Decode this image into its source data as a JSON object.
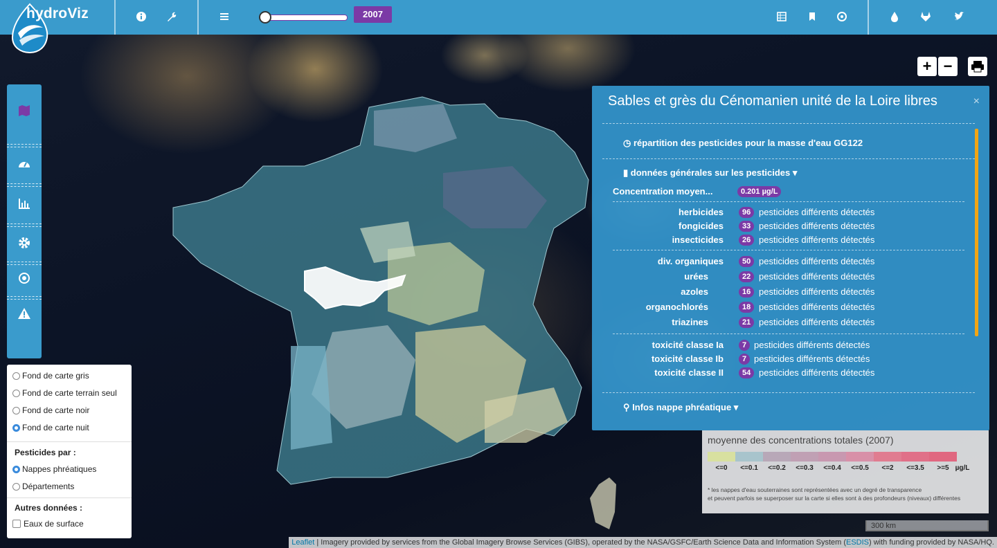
{
  "app": {
    "name": "hydroViz"
  },
  "toolbar": {
    "year": "2007",
    "icons_left": [
      "info-icon",
      "wrench-icon",
      "menu-icon"
    ],
    "icons_right": [
      "table-icon",
      "bookmark-icon",
      "target-icon"
    ],
    "icons_social": [
      "water-drop-icon",
      "gitlab-icon",
      "twitter-icon"
    ]
  },
  "map_controls": {
    "zoom_in": "+",
    "zoom_out": "−",
    "print_icon": "print-icon"
  },
  "sidebar": {
    "items": [
      "map-icon",
      "dashboard-icon",
      "bar-chart-icon",
      "settings-icon",
      "target-icon",
      "warning-icon"
    ],
    "accent": "#7b3aa6"
  },
  "layers": {
    "basemaps": [
      {
        "label": "Fond de carte gris",
        "checked": false
      },
      {
        "label": "Fond de carte terrain seul",
        "checked": false
      },
      {
        "label": "Fond de carte noir",
        "checked": false
      },
      {
        "label": "Fond de carte nuit",
        "checked": true
      }
    ],
    "pesticides_header": "Pesticides par :",
    "pesticides": [
      {
        "label": "Nappes phréatiques",
        "checked": true
      },
      {
        "label": "Départements",
        "checked": false
      }
    ],
    "other_header": "Autres données :",
    "other": [
      {
        "label": "Eaux de surface",
        "checked": false
      }
    ]
  },
  "popup": {
    "title": "Sables et grès du Cénomanien unité de la Loire libres",
    "close": "×",
    "section_repartition": "répartition des pesticides pour la masse d'eau GG122",
    "section_general": "données générales sur les pesticides",
    "concentration_label": "Concentration moyen...",
    "concentration_value": "0.201 µg/L",
    "detected_text": "pesticides différents détectés",
    "groups": [
      [
        {
          "label": "herbicides",
          "count": "96"
        },
        {
          "label": "fongicides",
          "count": "33"
        },
        {
          "label": "insecticides",
          "count": "26"
        }
      ],
      [
        {
          "label": "div. organiques",
          "count": "50"
        },
        {
          "label": "urées",
          "count": "22"
        },
        {
          "label": "azoles",
          "count": "16"
        },
        {
          "label": "organochlorés",
          "count": "18"
        },
        {
          "label": "triazines",
          "count": "21"
        }
      ],
      [
        {
          "label": "toxicité classe Ia",
          "count": "7"
        },
        {
          "label": "toxicité classe Ib",
          "count": "7"
        },
        {
          "label": "toxicité classe II",
          "count": "54"
        }
      ]
    ],
    "section_nappe": "Infos nappe phréatique"
  },
  "legend": {
    "title": "moyenne des concentrations totales (2007)",
    "classes": [
      {
        "label": "<=0",
        "color": "#d8e0a0"
      },
      {
        "label": "<=0.1",
        "color": "#a8c4cc"
      },
      {
        "label": "<=0.2",
        "color": "#b8a8b8"
      },
      {
        "label": "<=0.3",
        "color": "#c0a0b4"
      },
      {
        "label": "<=0.4",
        "color": "#c898b0"
      },
      {
        "label": "<=0.5",
        "color": "#d890a8"
      },
      {
        "label": "<=2",
        "color": "#e07c90"
      },
      {
        "label": "<=3.5",
        "color": "#e07088"
      },
      {
        "label": ">=5",
        "color": "#e06880"
      }
    ],
    "unit": "µg/L",
    "note1": "* les nappes d'eau souterraines sont représentées avec un degré de transparence",
    "note2": "et peuvent parfois se superposer sur la carte si elles sont à des profondeurs (niveaux) différentes"
  },
  "scale": "300 km",
  "attribution": {
    "leaflet": "Leaflet",
    "text_before": " | Imagery provided by services from the Global Imagery Browse Services (GIBS), operated by the NASA/GSFC/Earth Science Data and Information System (",
    "esdis": "ESDIS",
    "text_after": ") with funding provided by NASA/HQ."
  }
}
